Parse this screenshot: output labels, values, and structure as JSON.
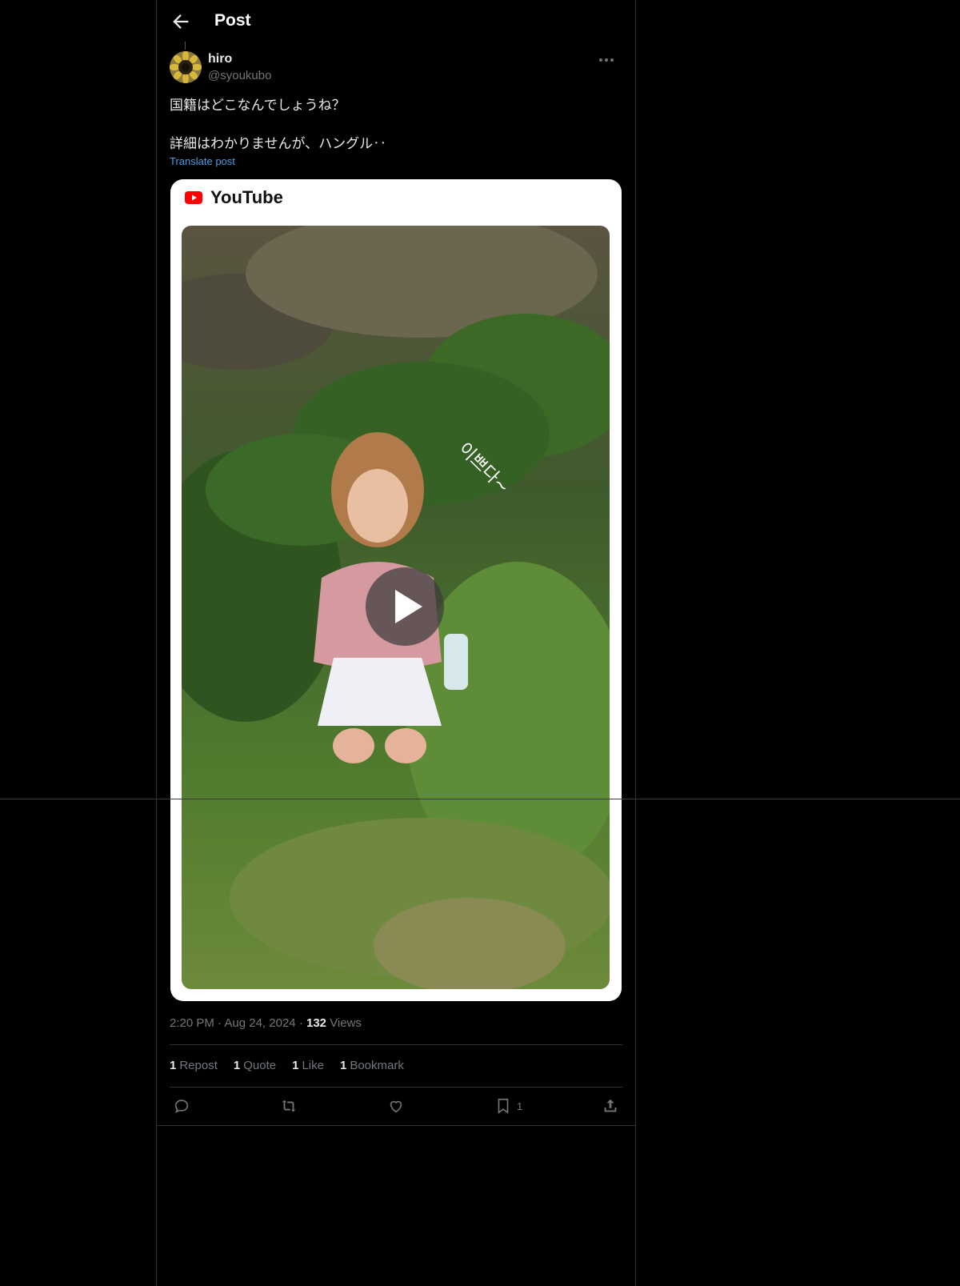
{
  "header": {
    "title": "Post"
  },
  "author": {
    "name": "hiro",
    "handle": "@syoukubo"
  },
  "post": {
    "line1": "国籍はどこなんでしょうね？",
    "line2": "詳細はわかりませんが、ハングル‥",
    "translate_label": "Translate post"
  },
  "card": {
    "source": "YouTube",
    "overlay_text": "이쁘다~"
  },
  "meta": {
    "time": "2:20 PM",
    "date": "Aug 24, 2024",
    "views_count": "132",
    "views_label": "Views"
  },
  "stats": [
    {
      "count": "1",
      "label": "Repost"
    },
    {
      "count": "1",
      "label": "Quote"
    },
    {
      "count": "1",
      "label": "Like"
    },
    {
      "count": "1",
      "label": "Bookmark"
    }
  ],
  "actions": {
    "bookmark_count": "1"
  },
  "icons": [
    "back-arrow-icon",
    "more-icon",
    "youtube-icon",
    "play-icon",
    "reply-icon",
    "repost-icon",
    "like-icon",
    "bookmark-icon",
    "share-icon"
  ],
  "colors": {
    "background": "#000000",
    "link": "#4a9de6",
    "muted": "#71767b",
    "youtube_red": "#ff0000"
  }
}
